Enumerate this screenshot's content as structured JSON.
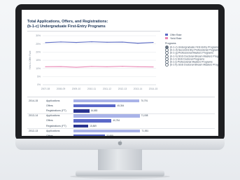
{
  "report": {
    "title": "Total Applications, Offers, and Registrations:",
    "subtitle": "(b-1-c) Undergraduate First-Entry Programs"
  },
  "chart_data": {
    "type": "line",
    "x": [
      "2007-08",
      "2008-09",
      "2009-10",
      "2010-11",
      "2011-12",
      "2012-13",
      "2013-14",
      "2014-15"
    ],
    "y_ticks": [
      "30%",
      "25%",
      "20%",
      "15%",
      "10%",
      "5%",
      "0%"
    ],
    "ylabel": "Yield & Offer Rate",
    "ylim": [
      0,
      30
    ],
    "series": [
      {
        "name": "Offer Rate",
        "color": "#5b6bc4",
        "values": [
          25.8,
          26.2,
          25.9,
          26.3,
          26.0,
          26.1,
          25.4,
          25.9
        ]
      },
      {
        "name": "Yield Rate",
        "color": "#e987b5",
        "values": [
          11.0,
          11.1,
          10.7,
          11.2,
          11.0,
          11.3,
          11.0,
          10.9
        ]
      }
    ],
    "grid": true,
    "legend": "right"
  },
  "legend": {
    "series": [
      {
        "label": "Offer Rate",
        "color": "#5b6bc4"
      },
      {
        "label": "Yield Rate",
        "color": "#e987b5"
      }
    ],
    "programs_label": "Programs",
    "programs": [
      {
        "label": "(b-1-c) Undergraduate First-Entry Programs",
        "selected": true
      },
      {
        "label": "(b-1-d) Second-Entry Professional Programs",
        "selected": false
      },
      {
        "label": "(b-1-g) Professional Masters Programs",
        "selected": false
      },
      {
        "label": "(b-1-h) SGS Doctoral-Stream Masters Program",
        "selected": false
      },
      {
        "label": "(b-1-i) SGS Doctoral Programs",
        "selected": false
      },
      {
        "label": "(b-1-j) Professional Masters Programs",
        "selected": false
      },
      {
        "label": "(b-1-k) SGS Doctoral-Stream Masters Programs",
        "selected": false
      }
    ]
  },
  "bars": {
    "colors": {
      "Applications": "#a9b3e8",
      "Offers": "#5a68c8",
      "Registrations (FT)": "#2a3490"
    },
    "rows": [
      {
        "year": "2014-15",
        "label": "Applications",
        "value": 70.791,
        "text": "70,791"
      },
      {
        "year": "",
        "label": "Offers",
        "value": 45.354,
        "text": "45,354"
      },
      {
        "year": "",
        "label": "Registrations (FT)",
        "value": 16.883,
        "text": "16,883"
      },
      {
        "year": "2013-14",
        "label": "Applications",
        "value": 71.008,
        "text": "71,008"
      },
      {
        "year": "",
        "label": "Offers",
        "value": 40.754,
        "text": "40,754"
      },
      {
        "year": "",
        "label": "Registrations (FT)",
        "value": 15.869,
        "text": "15,869"
      },
      {
        "year": "2012-13",
        "label": "Applications",
        "value": 71.551,
        "text": "71,551"
      },
      {
        "year": "",
        "label": "Offers",
        "value": 33.855,
        "text": "33,855"
      }
    ]
  },
  "device": {
    "logo": "apple-logo"
  }
}
